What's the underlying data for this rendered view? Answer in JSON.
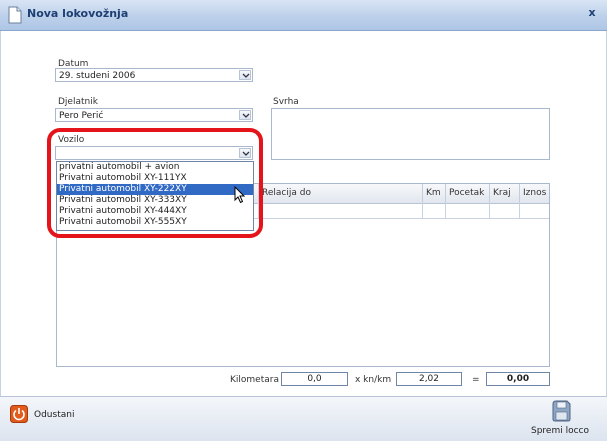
{
  "window": {
    "title": "Nova lokovožnja",
    "close_label": "x"
  },
  "form": {
    "datum_label": "Datum",
    "datum_value": "29. studeni 2006",
    "djelatnik_label": "Djelatnik",
    "djelatnik_value": "Pero Perić",
    "svrha_label": "Svrha",
    "vozilo_label": "Vozilo",
    "vozilo_value": ""
  },
  "vozilo_options": [
    "privatni automobil + avion",
    "Privatni automobil XY-111YX",
    "Privatni automobil XY-222XY",
    "Privatni automobil XY-333XY",
    "Privatni automobil XY-444XY",
    "Privatni automobil XY-555XY"
  ],
  "vozilo_selected_index": 2,
  "grid": {
    "columns": [
      "Relacija do",
      "Km",
      "Pocetak",
      "Kraj",
      "Iznos"
    ]
  },
  "totals": {
    "kilometara_label": "Kilometara",
    "kilometara_value": "0,0",
    "rate_label": "x kn/km",
    "rate_value": "2,02",
    "equals_label": "=",
    "total_value": "0,00"
  },
  "buttons": {
    "cancel_label": "Odustani",
    "save_label": "Spremi locco"
  },
  "colors": {
    "highlight": "#e5141a",
    "selection": "#316ac5"
  }
}
